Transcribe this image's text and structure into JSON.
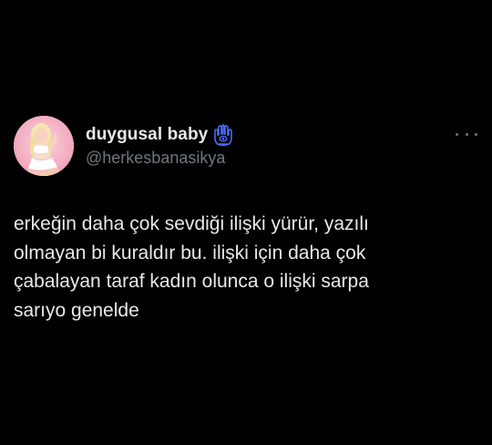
{
  "tweet": {
    "display_name": "duygusal baby",
    "handle": "@herkesbanasikya",
    "badge_icon": "hamsa-evil-eye-icon",
    "more_icon": "more-options-icon",
    "text": "erkeğin daha çok sevdiği ilişki yürür, yazılı\nolmayan bi kuraldır bu. ilişki için daha çok\nçabalayan taraf kadın olunca o ilişki sarpa\nsarıyo genelde"
  },
  "colors": {
    "background": "#000000",
    "primary_text": "#e7e9ea",
    "secondary_text": "#71767b",
    "badge_blue": "#4a6cf7"
  }
}
